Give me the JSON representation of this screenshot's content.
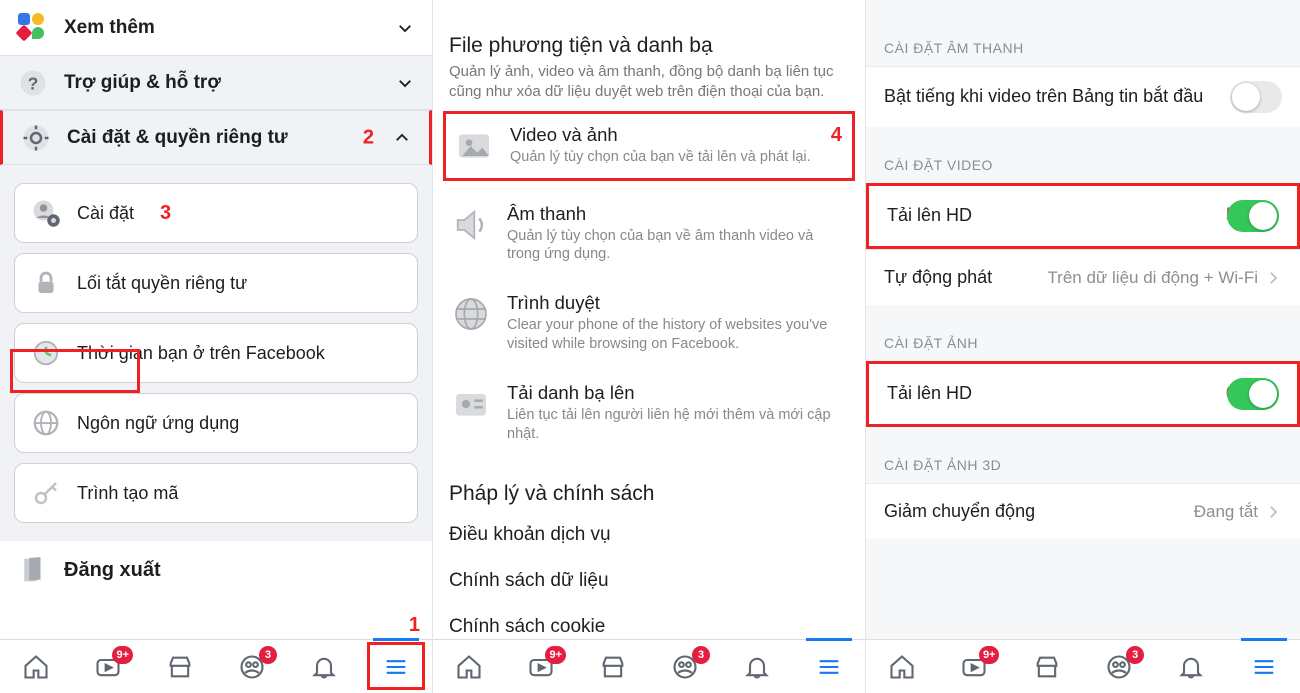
{
  "screen1": {
    "xem_them": "Xem thêm",
    "tro_giup": "Trợ giúp & hỗ trợ",
    "cai_dat_rieng_tu": "Cài đặt & quyền riêng tư",
    "num2": "2",
    "items": {
      "cai_dat": "Cài đặt",
      "num3": "3",
      "loi_tat": "Lối tắt quyền riêng tư",
      "thoi_gian": "Thời gian bạn ở trên Facebook",
      "ngon_ngu": "Ngôn ngữ ứng dụng",
      "trinh_tao_ma": "Trình tạo mã"
    },
    "dang_xuat": "Đăng xuất"
  },
  "screen2": {
    "title": "File phương tiện và danh bạ",
    "subtitle": "Quản lý ảnh, video và âm thanh, đồng bộ danh bạ liên tục cũng như xóa dữ liệu duyệt web trên điện thoại của bạn.",
    "items": {
      "video": {
        "t1": "Video và ảnh",
        "t2": "Quản lý tùy chọn của bạn về tải lên và phát lại.",
        "num": "4"
      },
      "audio": {
        "t1": "Âm thanh",
        "t2": "Quản lý tùy chọn của bạn về âm thanh video và trong ứng dụng."
      },
      "browser": {
        "t1": "Trình duyệt",
        "t2": "Clear your phone of the history of websites you've visited while browsing on Facebook."
      },
      "contacts": {
        "t1": "Tải danh bạ lên",
        "t2": "Liên tục tải lên người liên hệ mới thêm và mới cập nhật."
      }
    },
    "legal": {
      "title": "Pháp lý và chính sách",
      "terms": "Điều khoản dịch vụ",
      "data": "Chính sách dữ liệu",
      "cookie": "Chính sách cookie"
    }
  },
  "screen3": {
    "audio_header": "CÀI ĐẶT ÂM THANH",
    "audio_row": "Bật tiếng khi video trên Bảng tin bắt đầu",
    "video_header": "CÀI ĐẶT VIDEO",
    "video_hd": "Tải lên HD",
    "num5": "5",
    "autoplay_label": "Tự động phát",
    "autoplay_value": "Trên dữ liệu di động + Wi-Fi",
    "photo_header": "CÀI ĐẶT ẢNH",
    "photo_hd": "Tải lên HD",
    "num6": "6",
    "photo3d_header": "CÀI ĐẶT ẢNH 3D",
    "motion_label": "Giảm chuyển động",
    "motion_value": "Đang tắt"
  },
  "bottombar": {
    "badge_watch": "9+",
    "badge_groups": "3",
    "num1": "1"
  }
}
